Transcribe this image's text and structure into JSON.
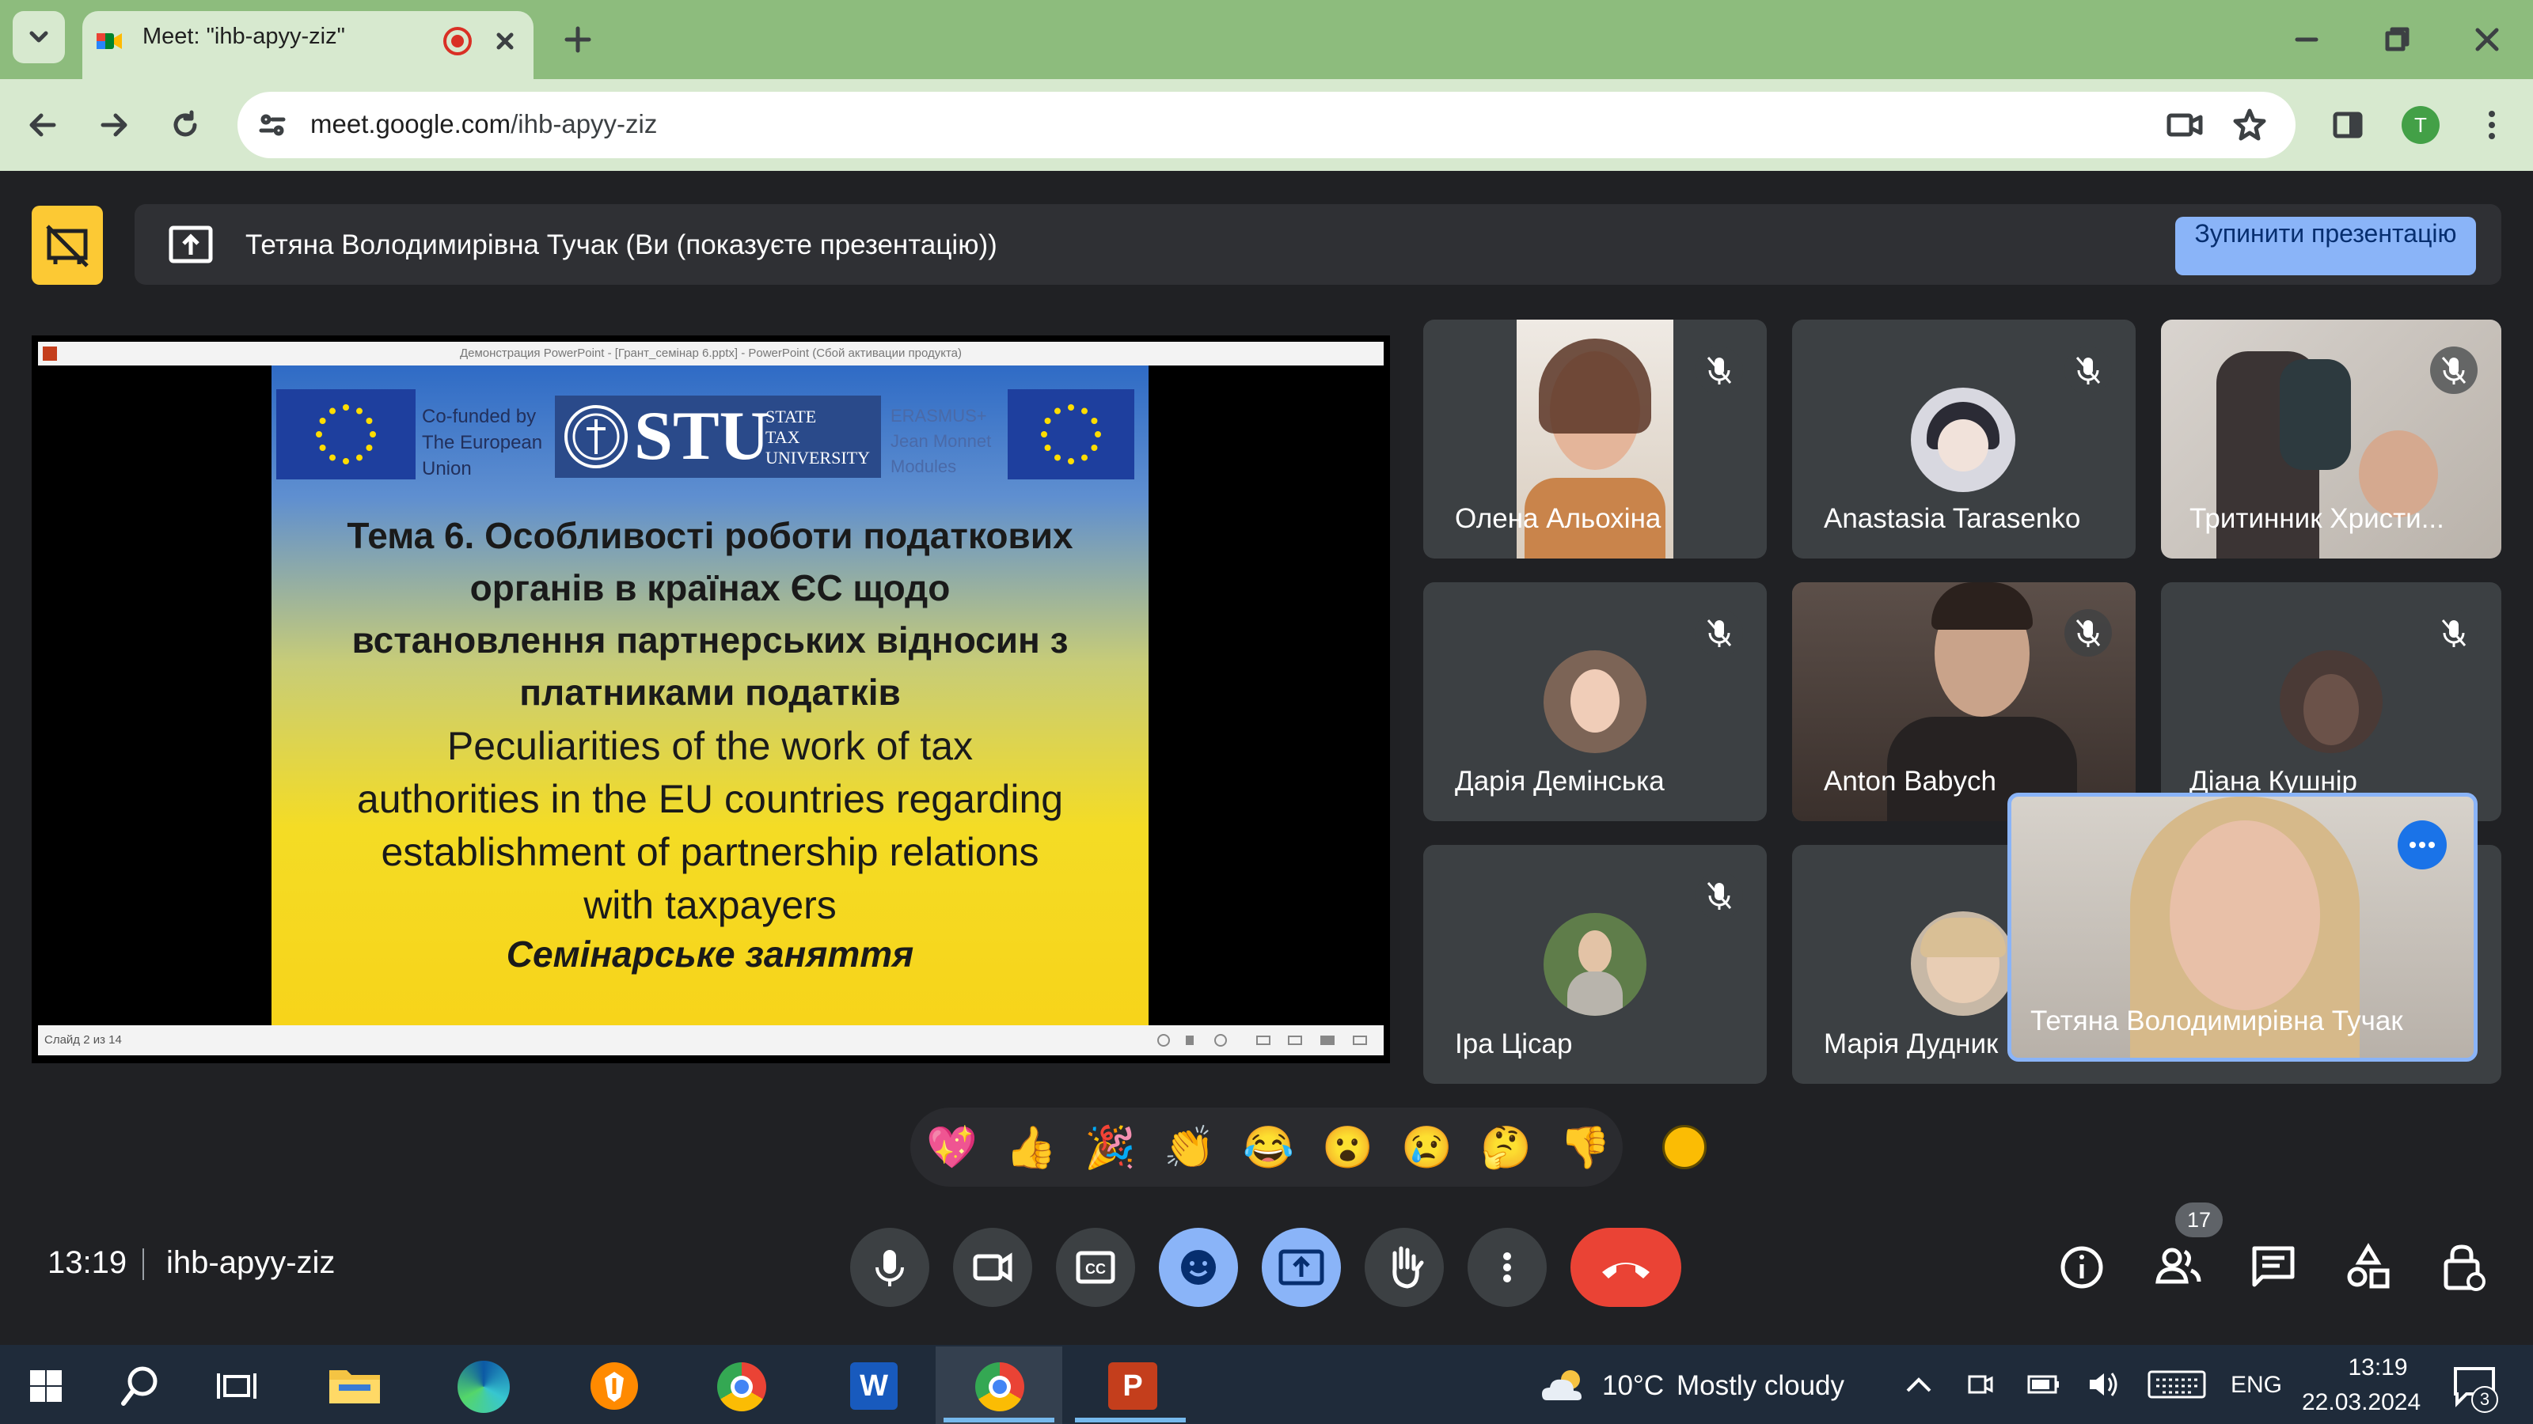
{
  "browser": {
    "tab_title": "Meet: \"ihb-apyy-ziz\"",
    "url_host": "meet.google.com",
    "url_path": "/ihb-apyy-ziz",
    "profile_initial": "T"
  },
  "meet": {
    "presenter_text": "Тетяна Володимирівна Тучак (Ви (показуєте презентацію))",
    "stop_button": "Зупинити презентацію",
    "time": "13:19",
    "meeting_code": "ihb-apyy-ziz",
    "participants_badge": "17"
  },
  "slide": {
    "ppt_window_title": "Демонстрация PowerPoint - [Грант_семінар 6.pptx] - PowerPoint (Сбой активации продукта)",
    "cofunded": [
      "Co-funded by",
      "The European",
      "Union"
    ],
    "stu_logo": "STU",
    "stu_sub": [
      "STATE",
      "TAX",
      "UNIVERSITY"
    ],
    "erasmus": [
      "ERASMUS+",
      "Jean Monnet",
      "Modules"
    ],
    "title_ua": [
      "Тема 6. Особливості роботи податкових",
      "органів в країнах ЄС щодо",
      "встановлення партнерських відносин з",
      "платниками податків"
    ],
    "title_en": [
      "Peculiarities of the work of tax",
      "authorities in the EU countries regarding",
      "establishment of partnership relations",
      "with taxpayers"
    ],
    "subtitle": "Семінарське заняття",
    "status": "Слайд 2 из 14"
  },
  "participants": [
    {
      "name": "Олена Альохіна"
    },
    {
      "name": "Anastasia Tarasenko"
    },
    {
      "name": "Тритинник Христи..."
    },
    {
      "name": "Дарія Демінська"
    },
    {
      "name": "Anton Babych"
    },
    {
      "name": "Діана Кушнір"
    },
    {
      "name": "Іра Цісар"
    },
    {
      "name": "Марія Дудник"
    }
  ],
  "self_view": {
    "name": "Тетяна Володимирівна Тучак"
  },
  "reactions": [
    "💖",
    "👍",
    "🎉",
    "👏",
    "😂",
    "😮",
    "😢",
    "🤔",
    "👎"
  ],
  "taskbar": {
    "weather_temp": "10°C",
    "weather_text": "Mostly cloudy",
    "lang": "ENG",
    "clock_time": "13:19",
    "clock_date": "22.03.2024",
    "notifications": "3"
  },
  "colors": {
    "chrome_frame": "#8dbc7d",
    "chrome_toolbar": "#d7e9cf",
    "meet_bg": "#202124",
    "meet_blue": "#8ab4f8",
    "end_call_red": "#ea4335",
    "present_yellow": "#fcc934"
  }
}
